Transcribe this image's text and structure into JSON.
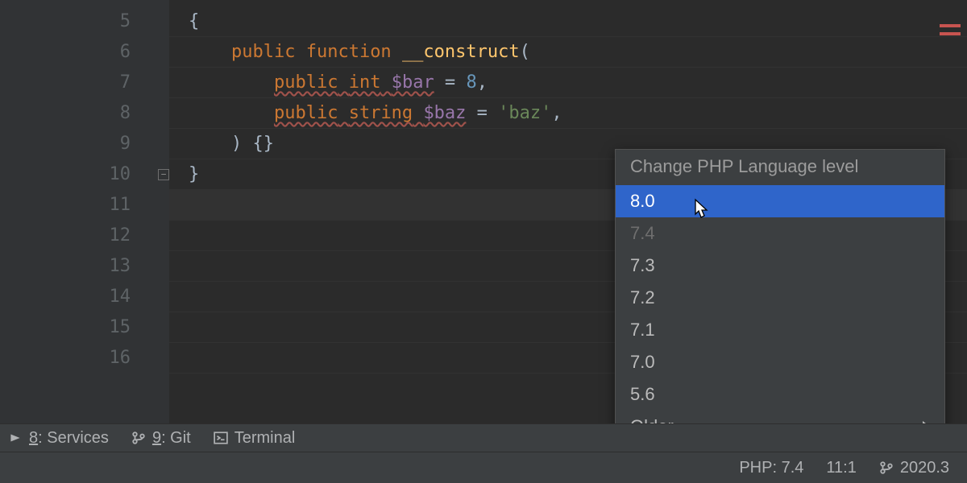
{
  "gutter": {
    "line_numbers": [
      5,
      6,
      7,
      8,
      9,
      10,
      11,
      12,
      13,
      14,
      15,
      16
    ]
  },
  "code": {
    "lines": [
      {
        "n": 5,
        "segments": [
          {
            "t": "{",
            "c": "tok-brace"
          }
        ],
        "indent": 0
      },
      {
        "n": 6,
        "segments": [
          {
            "t": "public",
            "c": "tok-keyword"
          },
          {
            "t": " "
          },
          {
            "t": "function",
            "c": "tok-keyword"
          },
          {
            "t": " "
          },
          {
            "t": "__construct",
            "c": "tok-func"
          },
          {
            "t": "(",
            "c": "tok-punct"
          }
        ],
        "indent": 1
      },
      {
        "n": 7,
        "segments": [
          {
            "t": "public",
            "c": "tok-keyword warn-underline"
          },
          {
            "t": " ",
            "c": "warn-underline"
          },
          {
            "t": "int",
            "c": "tok-type warn-underline"
          },
          {
            "t": " ",
            "c": "warn-underline"
          },
          {
            "t": "$bar",
            "c": "tok-var warn-underline"
          },
          {
            "t": " = ",
            "c": "tok-punct"
          },
          {
            "t": "8",
            "c": "tok-num"
          },
          {
            "t": ",",
            "c": "tok-punct"
          }
        ],
        "indent": 2
      },
      {
        "n": 8,
        "segments": [
          {
            "t": "public",
            "c": "tok-keyword warn-underline"
          },
          {
            "t": " ",
            "c": "warn-underline"
          },
          {
            "t": "string",
            "c": "tok-type warn-underline"
          },
          {
            "t": " ",
            "c": "warn-underline"
          },
          {
            "t": "$baz",
            "c": "tok-var warn-underline"
          },
          {
            "t": " = ",
            "c": "tok-punct"
          },
          {
            "t": "'baz'",
            "c": "tok-str"
          },
          {
            "t": ",",
            "c": "tok-punct"
          }
        ],
        "indent": 2
      },
      {
        "n": 9,
        "segments": [
          {
            "t": ") {}",
            "c": "tok-punct"
          }
        ],
        "indent": 1
      },
      {
        "n": 10,
        "segments": [
          {
            "t": "}",
            "c": "tok-brace"
          }
        ],
        "indent": 0,
        "fold": true
      },
      {
        "n": 11,
        "segments": [],
        "highlight": true
      },
      {
        "n": 12,
        "segments": []
      },
      {
        "n": 13,
        "segments": []
      },
      {
        "n": 14,
        "segments": []
      },
      {
        "n": 15,
        "segments": []
      },
      {
        "n": 16,
        "segments": []
      }
    ],
    "indent_unit": "    "
  },
  "popup": {
    "title": "Change PHP Language level",
    "items": [
      {
        "label": "8.0",
        "selected": true
      },
      {
        "label": "7.4",
        "disabled": true
      },
      {
        "label": "7.3"
      },
      {
        "label": "7.2"
      },
      {
        "label": "7.1"
      },
      {
        "label": "7.0"
      },
      {
        "label": "5.6"
      },
      {
        "label": "Older...",
        "submenu": true
      }
    ]
  },
  "tool_windows": [
    {
      "mnemonic": "8",
      "label": ": Services",
      "icon": "services-icon"
    },
    {
      "mnemonic": "9",
      "label": ": Git",
      "icon": "git-branch-icon"
    },
    {
      "mnemonic": "",
      "label": "Terminal",
      "icon": "terminal-icon"
    }
  ],
  "status": {
    "php": "PHP: 7.4",
    "caret": "11:1",
    "ide_version": "2020.3"
  }
}
